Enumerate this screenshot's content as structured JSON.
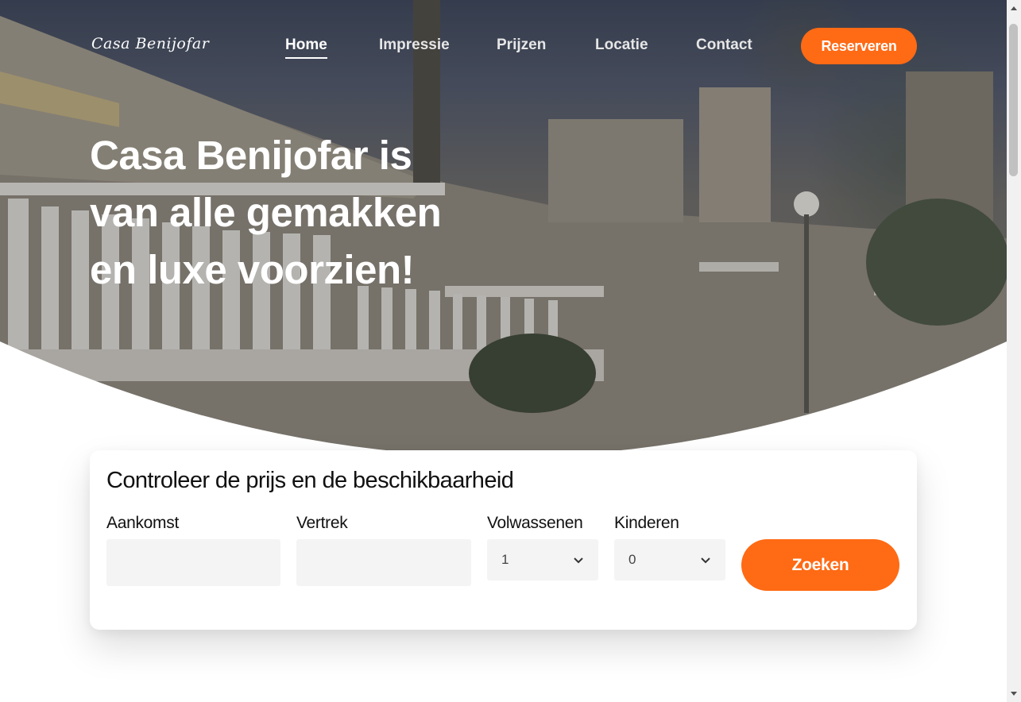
{
  "nav": {
    "logo": "Casa Benijofar",
    "links": [
      "Home",
      "Impressie",
      "Prijzen",
      "Locatie",
      "Contact"
    ],
    "active": "Home",
    "reserve_label": "Reserveren"
  },
  "hero": {
    "headline_lines": [
      "Casa Benijofar is",
      "van alle gemakken",
      "en luxe voorzien!"
    ]
  },
  "booking": {
    "title": "Controleer de prijs en de beschikbaarheid",
    "arrival_label": "Aankomst",
    "arrival_value": "",
    "departure_label": "Vertrek",
    "departure_value": "",
    "adults_label": "Volwassenen",
    "adults_value": "1",
    "children_label": "Kinderen",
    "children_value": "0",
    "search_label": "Zoeken"
  },
  "colors": {
    "accent": "#ff6a14",
    "input_bg": "#f4f4f4"
  },
  "icons": [
    "chevron-down-icon",
    "scroll-up-arrow-icon",
    "scroll-down-arrow-icon"
  ]
}
